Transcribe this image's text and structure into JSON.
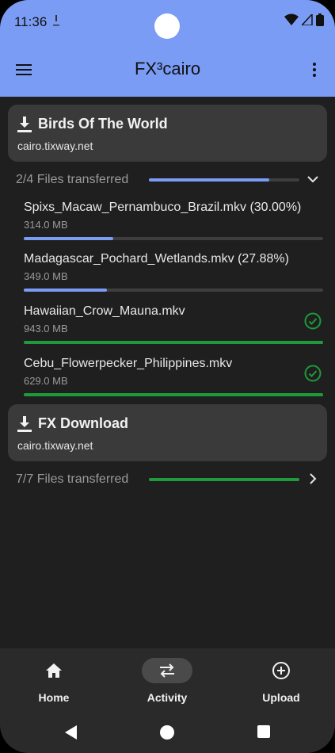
{
  "status_bar": {
    "time": "11:36"
  },
  "app_bar": {
    "title": "FX³cairo"
  },
  "downloads": [
    {
      "title": "Birds Of The World",
      "host": "cairo.tixway.net",
      "summary": "2/4 Files transferred",
      "summary_progress": 0.8,
      "summary_color": "#7b9cf4",
      "expanded": true,
      "files": [
        {
          "name": "Spixs_Macaw_Pernambuco_Brazil.mkv (30.00%)",
          "size": "314.0 MB",
          "progress": 0.3,
          "complete": false
        },
        {
          "name": "Madagascar_Pochard_Wetlands.mkv (27.88%)",
          "size": "349.0 MB",
          "progress": 0.2788,
          "complete": false
        },
        {
          "name": "Hawaiian_Crow_Mauna.mkv",
          "size": "943.0 MB",
          "progress": 1.0,
          "complete": true
        },
        {
          "name": "Cebu_Flowerpecker_Philippines.mkv",
          "size": "629.0 MB",
          "progress": 1.0,
          "complete": true
        }
      ]
    },
    {
      "title": "FX Download",
      "host": "cairo.tixway.net",
      "summary": "7/7 Files transferred",
      "summary_progress": 1.0,
      "summary_color": "#1e9a3a",
      "expanded": false,
      "files": []
    }
  ],
  "colors": {
    "accent": "#7b9cf4",
    "success": "#1e9a3a",
    "progress_track": "#3e3e3e"
  },
  "bottom_nav": [
    {
      "label": "Home",
      "icon": "home-icon",
      "active": false
    },
    {
      "label": "Activity",
      "icon": "swap-icon",
      "active": true
    },
    {
      "label": "Upload",
      "icon": "add-circle-icon",
      "active": false
    }
  ]
}
